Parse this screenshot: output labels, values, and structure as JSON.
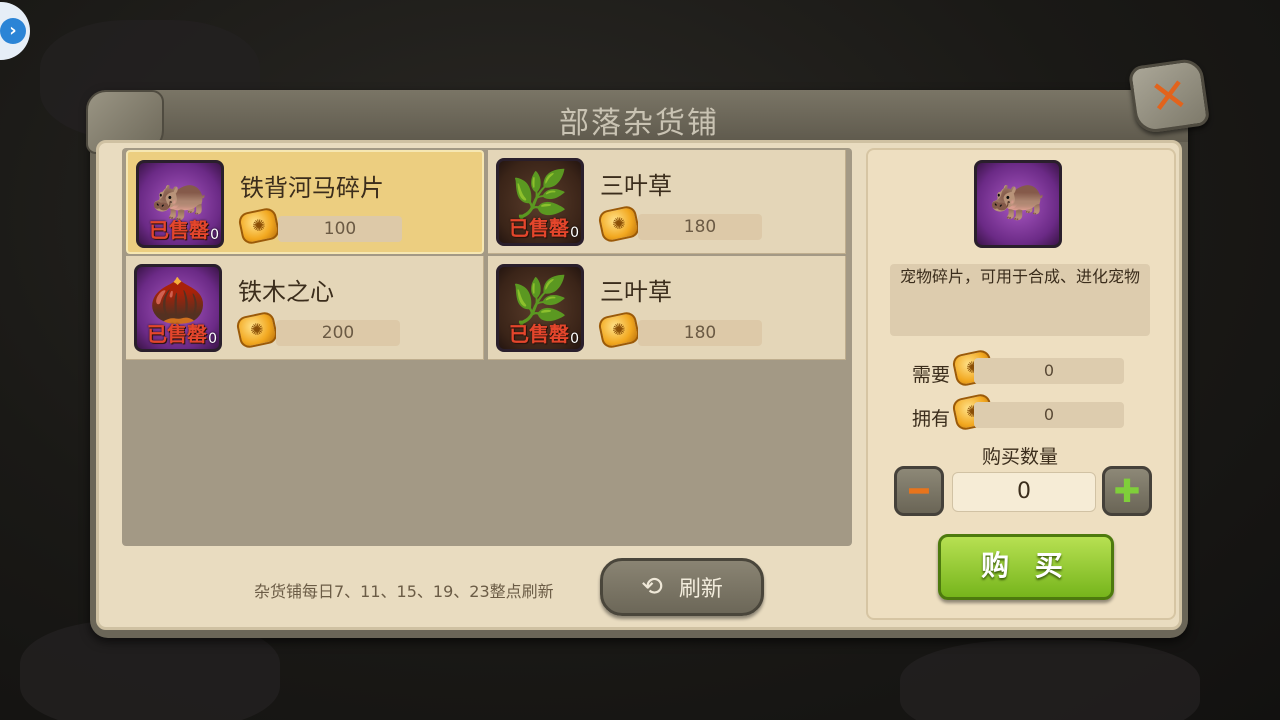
{
  "window": {
    "title": "部落杂货铺"
  },
  "items": [
    {
      "name": "铁背河马碎片",
      "price": "100",
      "status": "已售罄",
      "qty": "0",
      "icon": "hippo-fragment-icon",
      "selected": true
    },
    {
      "name": "三叶草",
      "price": "180",
      "status": "已售罄",
      "qty": "0",
      "icon": "clover-icon",
      "selected": false
    },
    {
      "name": "铁木之心",
      "price": "200",
      "status": "已售罄",
      "qty": "0",
      "icon": "ironwood-heart-icon",
      "selected": false
    },
    {
      "name": "三叶草",
      "price": "180",
      "status": "已售罄",
      "qty": "0",
      "icon": "clover-icon",
      "selected": false
    }
  ],
  "footer": {
    "refresh_note": "杂货铺每日7、11、15、19、23整点刷新",
    "refresh_label": "刷新"
  },
  "detail": {
    "description": "宠物碎片，可用于合成、进化宠物",
    "need_label": "需要",
    "need_value": "0",
    "own_label": "拥有",
    "own_value": "0",
    "quantity_title": "购买数量",
    "quantity_value": "0",
    "buy_label": "购 买"
  },
  "colors": {
    "accent": "#ecce80",
    "buy": "#8ec62c",
    "sold": "#e4462c",
    "close": "#e2631c"
  }
}
